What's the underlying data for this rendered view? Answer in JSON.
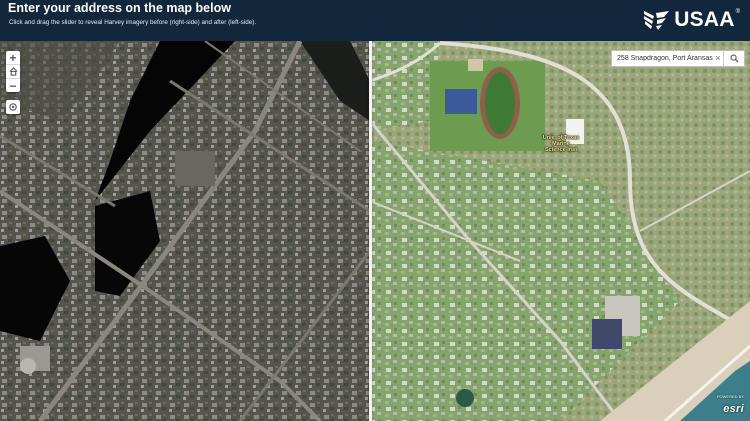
{
  "header": {
    "title": "Enter your address on the map below",
    "subtitle": "Click and drag the slider to reveal Harvey imagery before (right-side) and after (left-side).",
    "logo_text": "USAA",
    "logo_reg": "®"
  },
  "map_controls": {
    "zoom_in": "+",
    "home_icon": "home-icon",
    "zoom_out": "−",
    "locate_icon": "locate-icon"
  },
  "search": {
    "value": "258 Snapdragon, Port Aransas,",
    "clear_symbol": "×",
    "submit_icon": "search-icon"
  },
  "map_labels": {
    "campus": "Univ. of Texas Marine Science Inst"
  },
  "attribution": {
    "powered_by": "POWERED BY",
    "brand": "esri"
  },
  "colors": {
    "header_bg": "#12273b",
    "after_imagery_tone": "#4f4e48",
    "before_imagery_tone": "#7fa064",
    "sand": "#d9cfbb",
    "water": "#3c7f8a"
  }
}
